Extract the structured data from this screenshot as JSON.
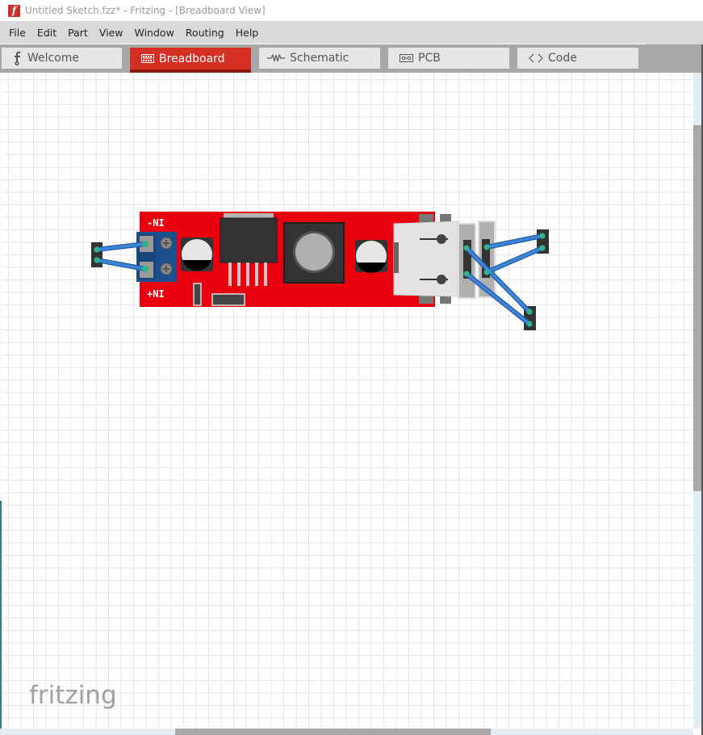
{
  "window": {
    "title": "Untitled Sketch.fzz* - Fritzing - [Breadboard View]",
    "app_icon": "fritzing-f-icon"
  },
  "menu": {
    "items": [
      "File",
      "Edit",
      "Part",
      "View",
      "Window",
      "Routing",
      "Help"
    ]
  },
  "tabs": [
    {
      "label": "Welcome",
      "icon": "fritzing-f-icon",
      "active": false
    },
    {
      "label": "Breadboard",
      "icon": "breadboard-icon",
      "active": true
    },
    {
      "label": "Schematic",
      "icon": "resistor-icon",
      "active": false
    },
    {
      "label": "PCB",
      "icon": "pcb-icon",
      "active": false
    },
    {
      "label": "Code",
      "icon": "code-brackets-icon",
      "active": false
    }
  ],
  "canvas": {
    "board": {
      "label_top": "-NI",
      "label_bottom": "+NI",
      "color": "#e8000e"
    },
    "wire_color": "#3674c8",
    "connector_color": "#2fb38a",
    "logo": "fritzing"
  },
  "colors": {
    "accent_tab": "#d52e22",
    "accent_tab_underline": "#8c1a12",
    "menubar_bg": "#d9d9d9",
    "tabbar_bg": "#a8a8a8"
  }
}
